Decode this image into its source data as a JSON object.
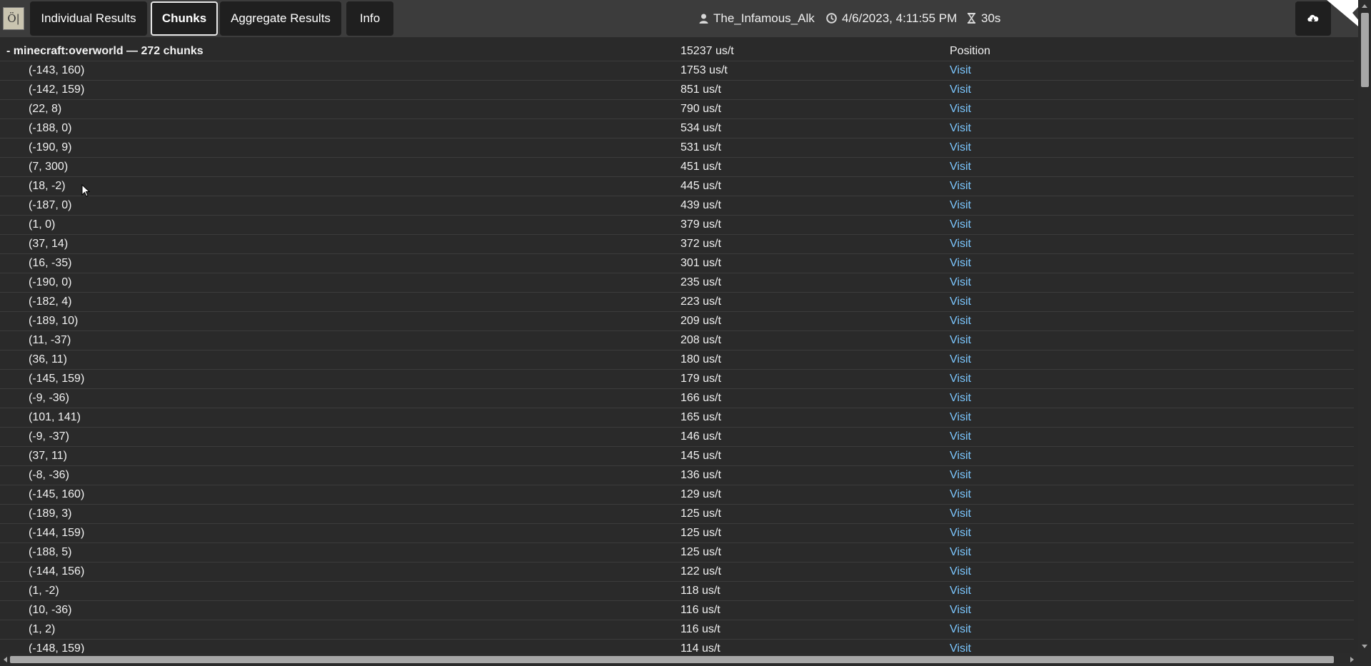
{
  "app": {
    "logo_text": "Ö|●|",
    "tabs": [
      {
        "label": "Individual Results",
        "active": false
      },
      {
        "label": "Chunks",
        "active": true
      },
      {
        "label": "Aggregate Results",
        "active": false
      },
      {
        "label": "Info",
        "active": false
      }
    ],
    "user": "The_Infamous_Alk",
    "datetime": "4/6/2023, 4:11:55 PM",
    "duration": "30s",
    "icons": {
      "user": "user-icon",
      "clock": "clock-icon",
      "duration": "hourglass-icon",
      "download": "cloud-download-icon"
    }
  },
  "table": {
    "group": {
      "label": "- minecraft:overworld — 272 chunks",
      "total": "15237 us/t",
      "position_header": "Position"
    },
    "link_label": "Visit",
    "rows": [
      {
        "chunk": "(-143, 160)",
        "time": "1753 us/t"
      },
      {
        "chunk": "(-142, 159)",
        "time": "851 us/t"
      },
      {
        "chunk": "(22, 8)",
        "time": "790 us/t"
      },
      {
        "chunk": "(-188, 0)",
        "time": "534 us/t"
      },
      {
        "chunk": "(-190, 9)",
        "time": "531 us/t"
      },
      {
        "chunk": "(7, 300)",
        "time": "451 us/t"
      },
      {
        "chunk": "(18, -2)",
        "time": "445 us/t"
      },
      {
        "chunk": "(-187, 0)",
        "time": "439 us/t"
      },
      {
        "chunk": "(1, 0)",
        "time": "379 us/t"
      },
      {
        "chunk": "(37, 14)",
        "time": "372 us/t"
      },
      {
        "chunk": "(16, -35)",
        "time": "301 us/t"
      },
      {
        "chunk": "(-190, 0)",
        "time": "235 us/t"
      },
      {
        "chunk": "(-182, 4)",
        "time": "223 us/t"
      },
      {
        "chunk": "(-189, 10)",
        "time": "209 us/t"
      },
      {
        "chunk": "(11, -37)",
        "time": "208 us/t"
      },
      {
        "chunk": "(36, 11)",
        "time": "180 us/t"
      },
      {
        "chunk": "(-145, 159)",
        "time": "179 us/t"
      },
      {
        "chunk": "(-9, -36)",
        "time": "166 us/t"
      },
      {
        "chunk": "(101, 141)",
        "time": "165 us/t"
      },
      {
        "chunk": "(-9, -37)",
        "time": "146 us/t"
      },
      {
        "chunk": "(37, 11)",
        "time": "145 us/t"
      },
      {
        "chunk": "(-8, -36)",
        "time": "136 us/t"
      },
      {
        "chunk": "(-145, 160)",
        "time": "129 us/t"
      },
      {
        "chunk": "(-189, 3)",
        "time": "125 us/t"
      },
      {
        "chunk": "(-144, 159)",
        "time": "125 us/t"
      },
      {
        "chunk": "(-188, 5)",
        "time": "125 us/t"
      },
      {
        "chunk": "(-144, 156)",
        "time": "122 us/t"
      },
      {
        "chunk": "(1, -2)",
        "time": "118 us/t"
      },
      {
        "chunk": "(10, -36)",
        "time": "116 us/t"
      },
      {
        "chunk": "(1, 2)",
        "time": "116 us/t"
      },
      {
        "chunk": "(-148, 159)",
        "time": "114 us/t"
      }
    ]
  },
  "colors": {
    "background": "#2a2a2a",
    "topbar": "#3c3c3c",
    "tab": "#1f1f1f",
    "link": "#7cc7ff",
    "row_divider": "#3c3c3c"
  }
}
